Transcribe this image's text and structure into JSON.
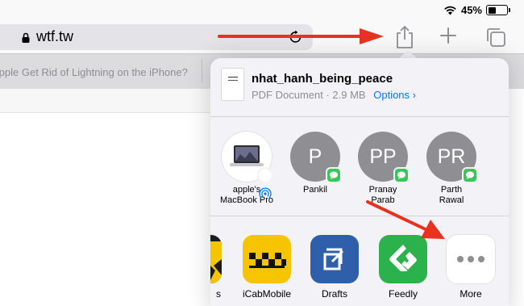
{
  "status": {
    "battery_text": "45%",
    "battery_level": 0.45
  },
  "toolbar": {
    "url": "wtf.tw",
    "icons": [
      "lock-icon",
      "reload-icon",
      "share-icon",
      "plus-icon",
      "tabs-icon"
    ]
  },
  "tab": {
    "title": "Apple Get Rid of Lightning on the iPhone?"
  },
  "share_sheet": {
    "document": {
      "name": "nhat_hanh_being_peace",
      "meta": "PDF Document · 2.9 MB",
      "options_label": "Options",
      "options_chevron": "›"
    },
    "people": [
      {
        "label_line1": "apple's",
        "label_line2": "MacBook Pro",
        "initials": "",
        "type": "airdrop"
      },
      {
        "label_line1": "Pankil",
        "label_line2": "",
        "initials": "P",
        "type": "message"
      },
      {
        "label_line1": "Pranay",
        "label_line2": "Parab",
        "initials": "PP",
        "type": "message"
      },
      {
        "label_line1": "Parth",
        "label_line2": "Rawal",
        "initials": "PR",
        "type": "message"
      }
    ],
    "apps": [
      {
        "label": "s",
        "icon": "partial-app-icon"
      },
      {
        "label": "iCabMobile",
        "icon": "icabmobile-icon"
      },
      {
        "label": "Drafts",
        "icon": "drafts-icon"
      },
      {
        "label": "Feedly",
        "icon": "feedly-icon"
      },
      {
        "label": "More",
        "icon": "more-icon"
      }
    ]
  },
  "colors": {
    "accent": "#007aff",
    "message_badge": "#34c759",
    "annotation_arrow": "#e8321e",
    "icab": "#f6c400",
    "drafts": "#2f5fab",
    "feedly": "#2bb24c"
  }
}
